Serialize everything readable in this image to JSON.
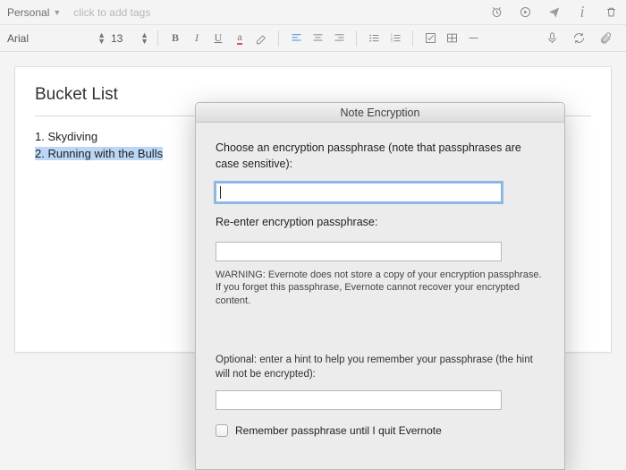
{
  "tagbar": {
    "notebook": "Personal",
    "tags_placeholder": "click to add tags"
  },
  "toolbar": {
    "font_family": "Arial",
    "font_size": "13"
  },
  "note": {
    "title": "Bucket List",
    "body": [
      "1. Skydiving",
      "2. Running with the Bulls"
    ]
  },
  "dialog": {
    "title": "Note Encryption",
    "passphrase_label": "Choose an encryption passphrase (note that passphrases are case sensitive):",
    "reenter_label": "Re-enter encryption passphrase:",
    "warning": "WARNING: Evernote does not store a copy of your encryption passphrase. If you forget this passphrase, Evernote cannot recover your encrypted content.",
    "hint_label": "Optional: enter a hint to help you remember your passphrase (the hint will not be encrypted):",
    "remember_label": "Remember passphrase until I quit Evernote"
  }
}
